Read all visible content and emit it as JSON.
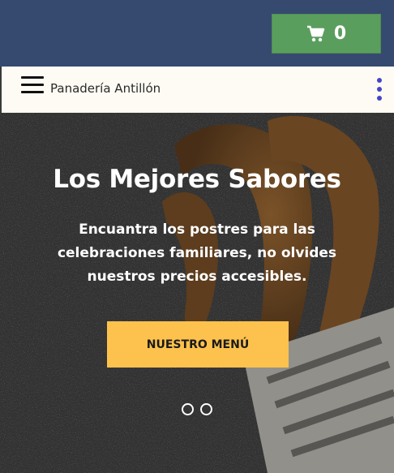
{
  "header": {
    "cart_icon": "cart-icon",
    "cart_count": "0",
    "colors": {
      "bar": "#364a70",
      "cart_button": "#5a9e5e"
    }
  },
  "navbar": {
    "brand": "Panadería Antillón",
    "menu_icon": "hamburger-icon",
    "more_icon": "more-vertical-icon",
    "colors": {
      "background": "#fdfbf3",
      "more_icon": "#4545c8"
    }
  },
  "hero": {
    "title": "Los Mejores Sabores",
    "subtitle": "Encuantra los postres para las celebraciones familiares, no olvides nuestros precios accesibles.",
    "cta_label": "NUESTRO MENÚ",
    "slides": 2,
    "colors": {
      "cta": "#fdc24d"
    }
  }
}
